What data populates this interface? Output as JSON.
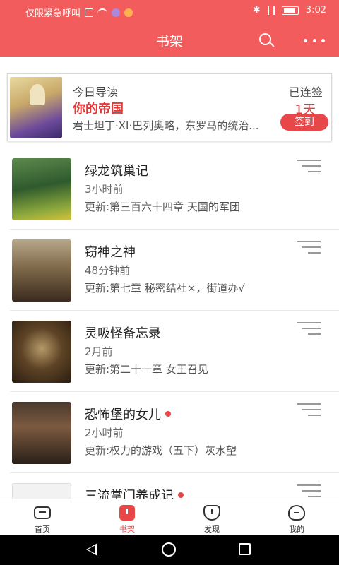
{
  "status_bar": {
    "carrier": "仅限紧急呼叫",
    "time": "3:02"
  },
  "header": {
    "title": "书架"
  },
  "today_card": {
    "label": "今日导读",
    "book_title": "你的帝国",
    "description": "君士坦丁·XI·巴列奥略，东罗马的统治...",
    "streak_label": "已连签",
    "streak_days": "1天",
    "signin_label": "签到"
  },
  "books": [
    {
      "title": "绿龙筑巢记",
      "time": "3小时前",
      "update": "更新:第三百六十四章 天国的军团",
      "has_update_dot": false
    },
    {
      "title": "窃神之神",
      "time": "48分钟前",
      "update": "更新:第七章 秘密结社×，街道办√",
      "has_update_dot": false
    },
    {
      "title": "灵吸怪备忘录",
      "time": "2月前",
      "update": "更新:第二十一章 女王召见",
      "has_update_dot": false
    },
    {
      "title": "恐怖堡的女儿",
      "time": "2小时前",
      "update": "更新:权力的游戏（五下）灰水望",
      "has_update_dot": true
    },
    {
      "title": "三流掌门养成记",
      "time": "",
      "update": "",
      "has_update_dot": true
    }
  ],
  "tabs": [
    {
      "label": "首页",
      "icon": "home-icon"
    },
    {
      "label": "书架",
      "icon": "bookshelf-icon"
    },
    {
      "label": "发现",
      "icon": "discover-icon"
    },
    {
      "label": "我的",
      "icon": "profile-icon"
    }
  ],
  "colors": {
    "brand": "#f25c5c",
    "accent": "#e8474a"
  }
}
